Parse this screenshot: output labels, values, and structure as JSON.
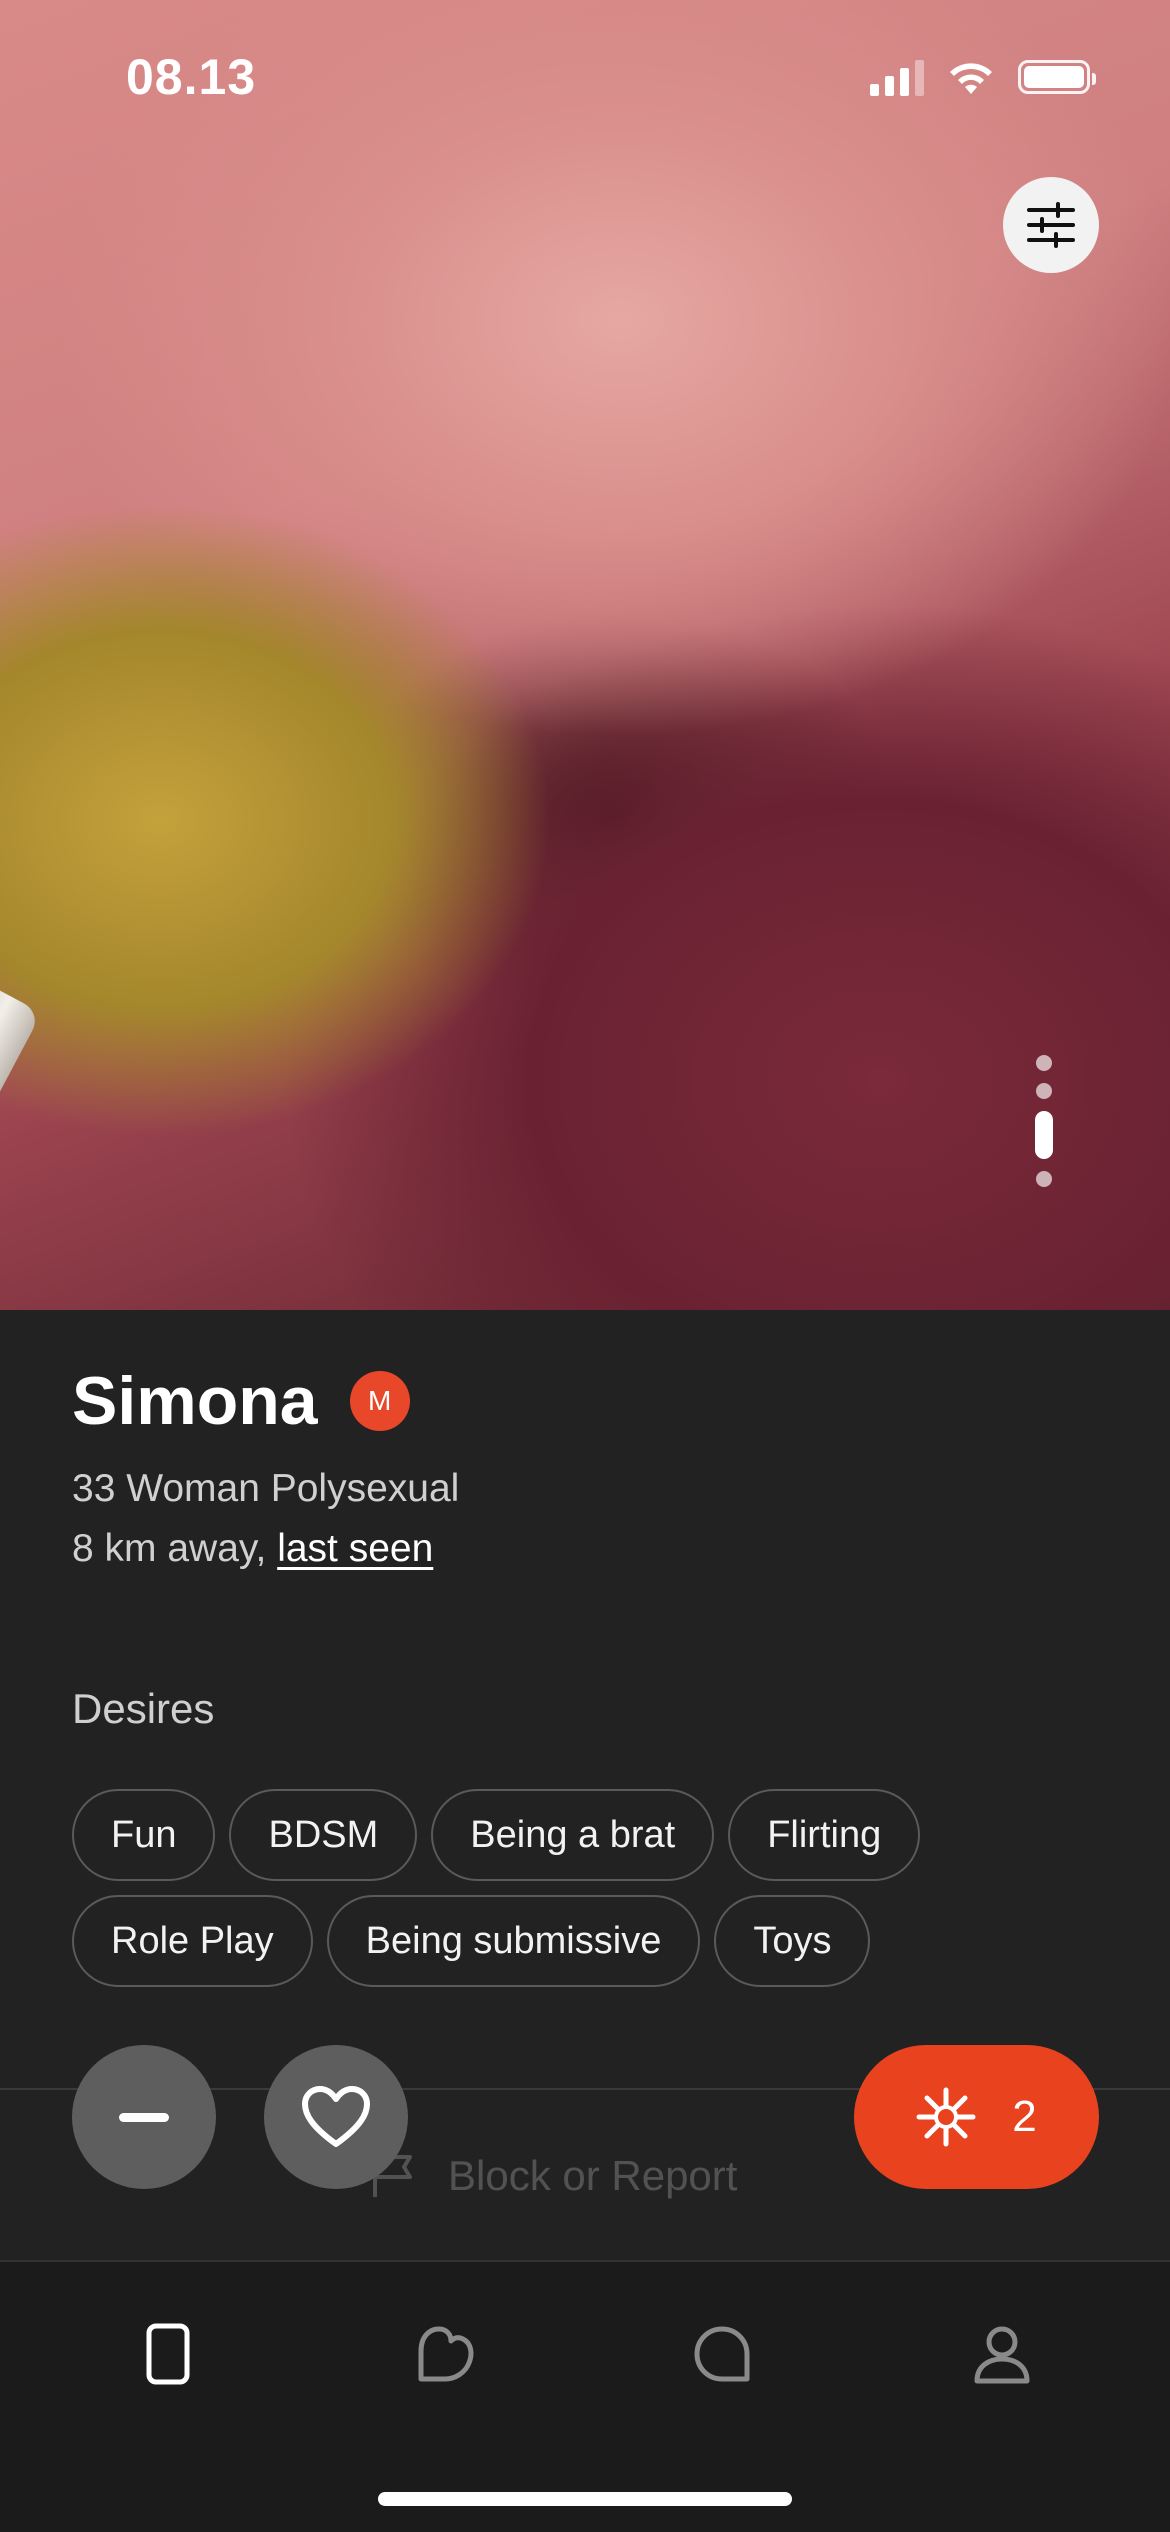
{
  "status_bar": {
    "time": "08.13"
  },
  "profile": {
    "name": "Simona",
    "badge": "M",
    "details": "33 Woman Polysexual",
    "distance": "8 km away,",
    "last_seen": "last seen",
    "photo_count": 4,
    "active_photo_index": 3
  },
  "desires": {
    "title": "Desires",
    "tags": [
      "Fun",
      "BDSM",
      "Being a brat",
      "Flirting",
      "Role Play",
      "Being submissive",
      "Toys"
    ]
  },
  "actions": {
    "spark_count": "2",
    "block_report": "Block or Report"
  },
  "colors": {
    "accent": "#e8421f",
    "background": "#222223",
    "tabbar": "#1b1b1c"
  },
  "tabs": [
    {
      "icon": "phone-card-icon",
      "active": true
    },
    {
      "icon": "likes-icon",
      "active": false
    },
    {
      "icon": "chat-icon",
      "active": false
    },
    {
      "icon": "profile-icon",
      "active": false
    }
  ]
}
